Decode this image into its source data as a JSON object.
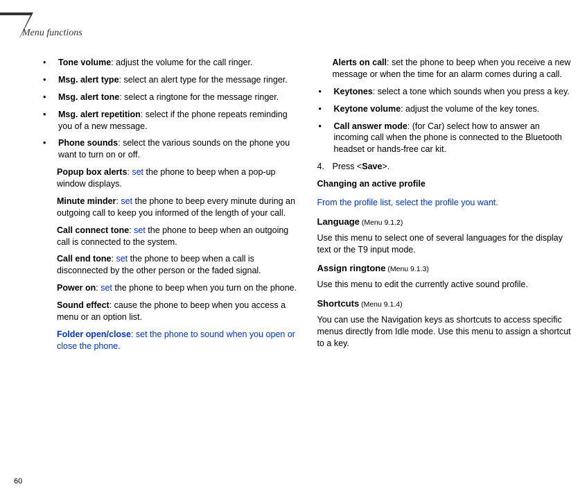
{
  "header": {
    "title": "Menu functions"
  },
  "page_number": "60",
  "col1": {
    "b1": {
      "label": "Tone volume",
      "desc": ": adjust the volume for the call ringer."
    },
    "b2": {
      "label": "Msg. alert type",
      "desc": ": select an alert type for the message ringer."
    },
    "b3": {
      "label": "Msg. alert tone",
      "desc": ": select a ringtone for the message ringer."
    },
    "b4": {
      "label": "Msg. alert repetition",
      "desc": ": select if the phone repeats reminding you of a new message."
    },
    "b5": {
      "label": "Phone sounds",
      "desc": ": select the various sounds on the phone you want to turn on or off."
    },
    "s1": {
      "label": "Popup box alerts",
      "desc_pre": ": ",
      "blue": "set",
      "desc_post": " the phone to beep when a pop-up window displays."
    },
    "s2": {
      "label": "Minute minder",
      "desc_pre": ": ",
      "blue": "set",
      "desc_post": " the phone to beep every minute during an outgoing call to keep you informed of the length of your call."
    },
    "s3": {
      "label": "Call connect tone",
      "desc_pre": ": ",
      "blue": "set",
      "desc_post": " the phone to beep when an outgoing call is connected to the system."
    },
    "s4": {
      "label": "Call end tone",
      "desc_pre": ": ",
      "blue": "set",
      "desc_post": " the phone to beep when a call is disconnected by the other person or the faded signal."
    },
    "s5": {
      "label": "Power on",
      "desc_pre": ": ",
      "blue": "set",
      "desc_post": " the phone to beep when you turn on the phone."
    },
    "s6": {
      "label": "Sound effect",
      "desc": ": cause the phone to beep when you access a menu or an option list."
    },
    "s7": {
      "label": "Folder open/close",
      "blue": ": set the phone to sound when you open or close the phone."
    }
  },
  "col2": {
    "s8": {
      "label": "Alerts on call",
      "desc": ": set the phone to beep when you receive a new message or when the time for an alarm comes during a call."
    },
    "b6": {
      "label": "Keytones",
      "desc": ": select a tone which sounds when you press a key."
    },
    "b7": {
      "label": "Keytone volume",
      "desc": ": adjust the volume of the key tones."
    },
    "b8": {
      "label": "Call answer mode",
      "desc": ": (for Car) select how to answer an incoming call when the phone is connected to the Bluetooth headset or hands-free car kit."
    },
    "step4": {
      "num": "4.",
      "pre": "Press <",
      "key": "Save",
      "post": ">."
    },
    "changing_heading": "Changing an active profile",
    "changing_blue": "From the profile list, select the profile you want.",
    "language": {
      "title": "Language",
      "menu": " (Menu 9.1.2)",
      "desc": "Use this menu to select one of several languages for the display text or the T9 input mode."
    },
    "assign": {
      "title": "Assign ringtone",
      "menu": " (Menu 9.1.3)",
      "desc": "Use this menu to edit the currently active sound profile."
    },
    "shortcuts": {
      "title": "Shortcuts",
      "menu": " (Menu 9.1.4)",
      "desc": "You can use the Navigation keys as shortcuts to access specific menus directly from Idle mode. Use this menu to assign a shortcut to a key."
    }
  }
}
